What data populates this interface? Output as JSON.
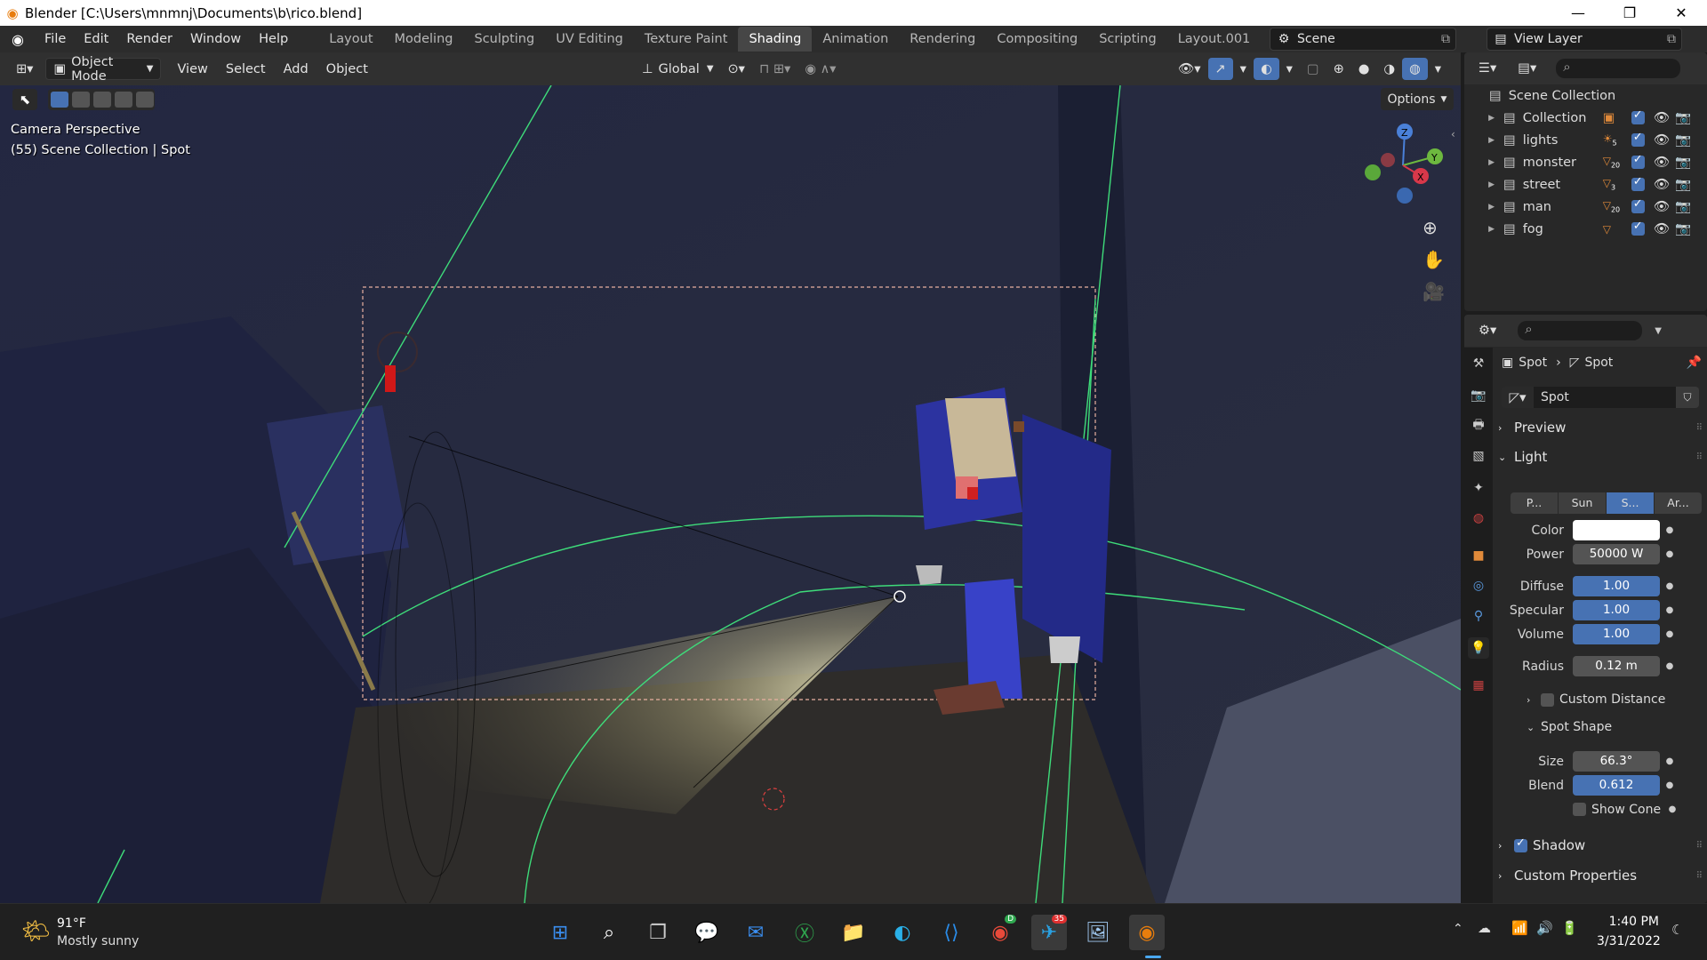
{
  "window": {
    "title": "Blender [C:\\Users\\mnmnj\\Documents\\b\\rico.blend]",
    "minimize": "—",
    "maximize": "❐",
    "close": "✕"
  },
  "menu": [
    "File",
    "Edit",
    "Render",
    "Window",
    "Help"
  ],
  "workspaces": [
    "Layout",
    "Modeling",
    "Sculpting",
    "UV Editing",
    "Texture Paint",
    "Shading",
    "Animation",
    "Rendering",
    "Compositing",
    "Scripting",
    "Layout.001"
  ],
  "active_workspace": "Shading",
  "add_workspace": "+",
  "scene": {
    "name": "Scene",
    "view_layer": "View Layer"
  },
  "viewport_header": {
    "mode": "Object Mode",
    "menus": [
      "View",
      "Select",
      "Add",
      "Object"
    ],
    "transform_orientation": "Global",
    "options": "Options"
  },
  "viewport_overlay": {
    "line1": "Camera Perspective",
    "line2": "(55) Scene Collection | Spot",
    "gizmo_axes": {
      "z": "Z",
      "y": "Y",
      "x": "X"
    }
  },
  "outliner": {
    "root": "Scene Collection",
    "items": [
      {
        "label": "Collection",
        "badge": ""
      },
      {
        "label": "lights",
        "badge": "5"
      },
      {
        "label": "monster",
        "badge": "20"
      },
      {
        "label": "street",
        "badge": "3"
      },
      {
        "label": "man",
        "badge": "20"
      },
      {
        "label": "fog",
        "badge": ""
      }
    ]
  },
  "properties": {
    "breadcrumb_object": "Spot",
    "breadcrumb_data": "Spot",
    "datablock": "Spot",
    "preview": "Preview",
    "light": "Light",
    "light_types": [
      "P...",
      "Sun",
      "S...",
      "Ar..."
    ],
    "active_light_type": "S...",
    "color_label": "Color",
    "color_value": "#ffffff",
    "power_label": "Power",
    "power": "50000 W",
    "diffuse_label": "Diffuse",
    "diffuse": "1.00",
    "specular_label": "Specular",
    "specular": "1.00",
    "volume_label": "Volume",
    "volume": "1.00",
    "radius_label": "Radius",
    "radius": "0.12 m",
    "custom_distance": "Custom Distance",
    "spot_shape": "Spot Shape",
    "size_label": "Size",
    "size": "66.3°",
    "blend_label": "Blend",
    "blend": "0.612",
    "show_cone": "Show Cone",
    "shadow": "Shadow",
    "custom_properties": "Custom Properties"
  },
  "taskbar": {
    "weather_temp": "91°F",
    "weather_desc": "Mostly sunny",
    "time": "1:40 PM",
    "date": "3/31/2022",
    "telegram_badge": "35",
    "chrome_badge": "D"
  }
}
